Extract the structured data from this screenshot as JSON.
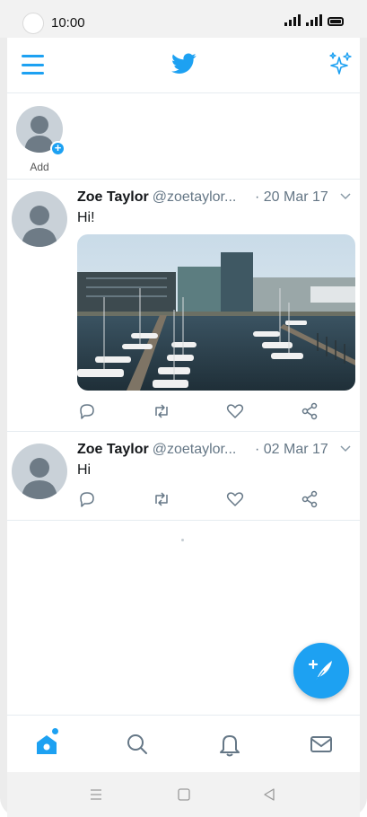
{
  "status_bar": {
    "time": "10:00"
  },
  "fleets": {
    "add_label": "Add"
  },
  "tweets": [
    {
      "name": "Zoe Taylor",
      "handle": "@zoetaylor...",
      "date": "· 20 Mar 17",
      "text": "Hi!",
      "has_photo": true
    },
    {
      "name": "Zoe Taylor",
      "handle": "@zoetaylor...",
      "date": "· 02 Mar 17",
      "text": "Hi",
      "has_photo": false
    }
  ],
  "colors": {
    "accent": "#1da1f2",
    "text": "#14171a",
    "muted": "#657786",
    "divider": "#e6ecf0"
  },
  "icons": {
    "top": [
      "menu-icon",
      "twitter-bird-icon",
      "sparkle-icon"
    ],
    "actions": [
      "reply-icon",
      "retweet-icon",
      "like-icon",
      "share-icon"
    ],
    "tabs": [
      "home-icon",
      "search-icon",
      "notifications-icon",
      "messages-icon"
    ],
    "system_nav": [
      "recents-icon",
      "home-nav-icon",
      "back-icon"
    ],
    "fab": "compose-tweet-icon"
  }
}
